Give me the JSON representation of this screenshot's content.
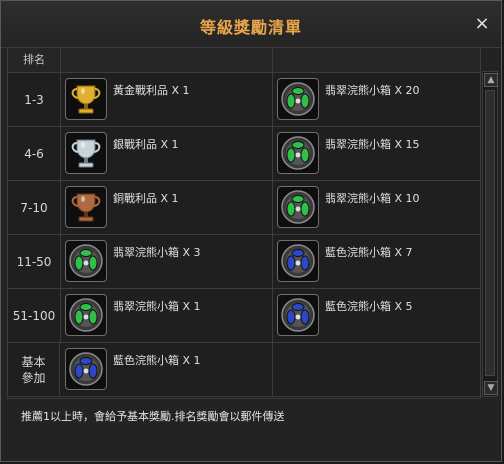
{
  "window": {
    "title": "等級獎勵清單",
    "close_label": "×"
  },
  "table": {
    "header": {
      "rank": "排名"
    },
    "rows": [
      {
        "rank": "1-3",
        "a": {
          "icon": "gold-trophy-icon",
          "label": "黃金戰利品 X 1"
        },
        "b": {
          "icon": "green-gem-box-icon",
          "label": "翡翠浣熊小箱 X 20"
        }
      },
      {
        "rank": "4-6",
        "a": {
          "icon": "silver-trophy-icon",
          "label": "銀戰利品 X 1"
        },
        "b": {
          "icon": "green-gem-box-icon",
          "label": "翡翠浣熊小箱 X 15"
        }
      },
      {
        "rank": "7-10",
        "a": {
          "icon": "bronze-trophy-icon",
          "label": "銅戰利品 X 1"
        },
        "b": {
          "icon": "green-gem-box-icon",
          "label": "翡翠浣熊小箱 X 10"
        }
      },
      {
        "rank": "11-50",
        "a": {
          "icon": "green-gem-box-icon",
          "label": "翡翠浣熊小箱 X 3"
        },
        "b": {
          "icon": "blue-gem-box-icon",
          "label": "藍色浣熊小箱 X 7"
        }
      },
      {
        "rank": "51-100",
        "a": {
          "icon": "green-gem-box-icon",
          "label": "翡翠浣熊小箱 X 1"
        },
        "b": {
          "icon": "blue-gem-box-icon",
          "label": "藍色浣熊小箱 X 5"
        }
      },
      {
        "rank": "基本參加",
        "a": {
          "icon": "blue-gem-box-icon",
          "label": "藍色浣熊小箱 X 1"
        },
        "b": null
      }
    ]
  },
  "scrollbar": {
    "up": "▲",
    "down": "▼"
  },
  "footer": "推薦1以上時，會給予基本獎勵.排名獎勵會以郵件傳送",
  "colors": {
    "title": "#e8a64a",
    "gold": "#e0b030",
    "silver": "#c8d4dc",
    "bronze": "#b06a40",
    "green_gem": "#2fbf4a",
    "blue_gem": "#2c48c8"
  }
}
